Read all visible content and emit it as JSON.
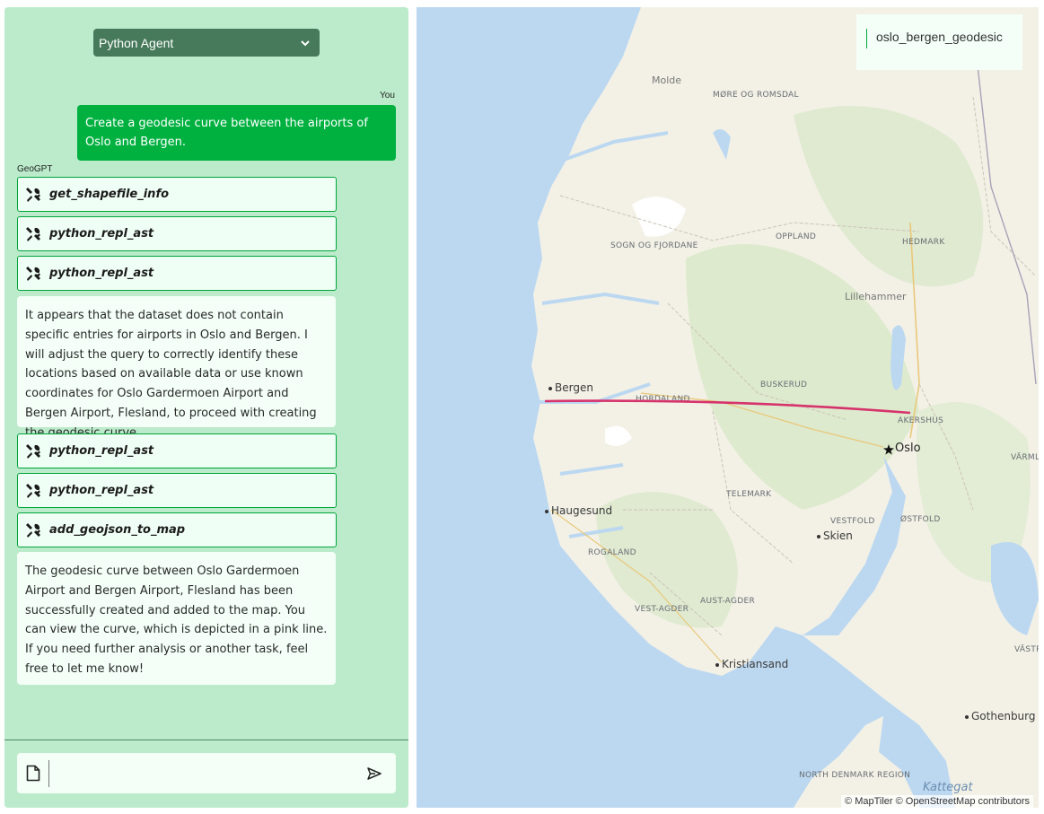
{
  "agent_select": {
    "value": "Python Agent"
  },
  "chat": {
    "user": {
      "sender": "You",
      "text": "Create a geodesic curve between the airports of Oslo and Bergen."
    },
    "assistant_sender": "GeoGPT",
    "tools_before": [
      "get_shapefile_info",
      "python_repl_ast",
      "python_repl_ast"
    ],
    "reply1": "It appears that the dataset does not contain specific entries for airports in Oslo and Bergen. I will adjust the query to correctly identify these locations based on available data or use known coordinates for Oslo Gardermoen Airport and Bergen Airport, Flesland, to proceed with creating the geodesic curve.",
    "tools_after": [
      "python_repl_ast",
      "python_repl_ast",
      "add_geojson_to_map"
    ],
    "reply2": "The geodesic curve between Oslo Gardermoen Airport and Bergen Airport, Flesland has been successfully created and added to the map. You can view the curve, which is depicted in a pink line. If you need further analysis or another task, feel free to let me know!"
  },
  "input": {
    "value": ""
  },
  "icons": {
    "tool": "tools-icon",
    "chevron": "chevron-down-icon",
    "attach": "file-icon",
    "send": "send-icon"
  },
  "map": {
    "layer_name": "oslo_bergen_geodesic",
    "attribution": "© MapTiler © OpenStreetMap contributors",
    "regions": [
      "MØRE OG ROMSDAL",
      "SOGN OG FJORDANE",
      "OPPLAND",
      "HEDMARK",
      "BUSKERUD",
      "HORDALAND",
      "AKERSHUS",
      "TELEMARK",
      "VESTFOLD",
      "ØSTFOLD",
      "ROGALAND",
      "AUST-AGDER",
      "VEST-AGDER",
      "NORTH DENMARK REGION",
      "VÄRMLAND",
      "VÄSTRA GÖTALAND COUNTY"
    ],
    "cities": [
      "Molde",
      "Lillehammer",
      "Bergen",
      "Oslo",
      "Haugesund",
      "Skien",
      "Kristiansand",
      "Gothenburg"
    ],
    "sea": "Kattegat",
    "route_color": "#d6336c",
    "colors": {
      "land": "#f3f1e6",
      "forest": "#d8e8c8",
      "water": "#bcd8f1",
      "panel": "#bbebcb",
      "user_bubble": "#00b140"
    }
  }
}
